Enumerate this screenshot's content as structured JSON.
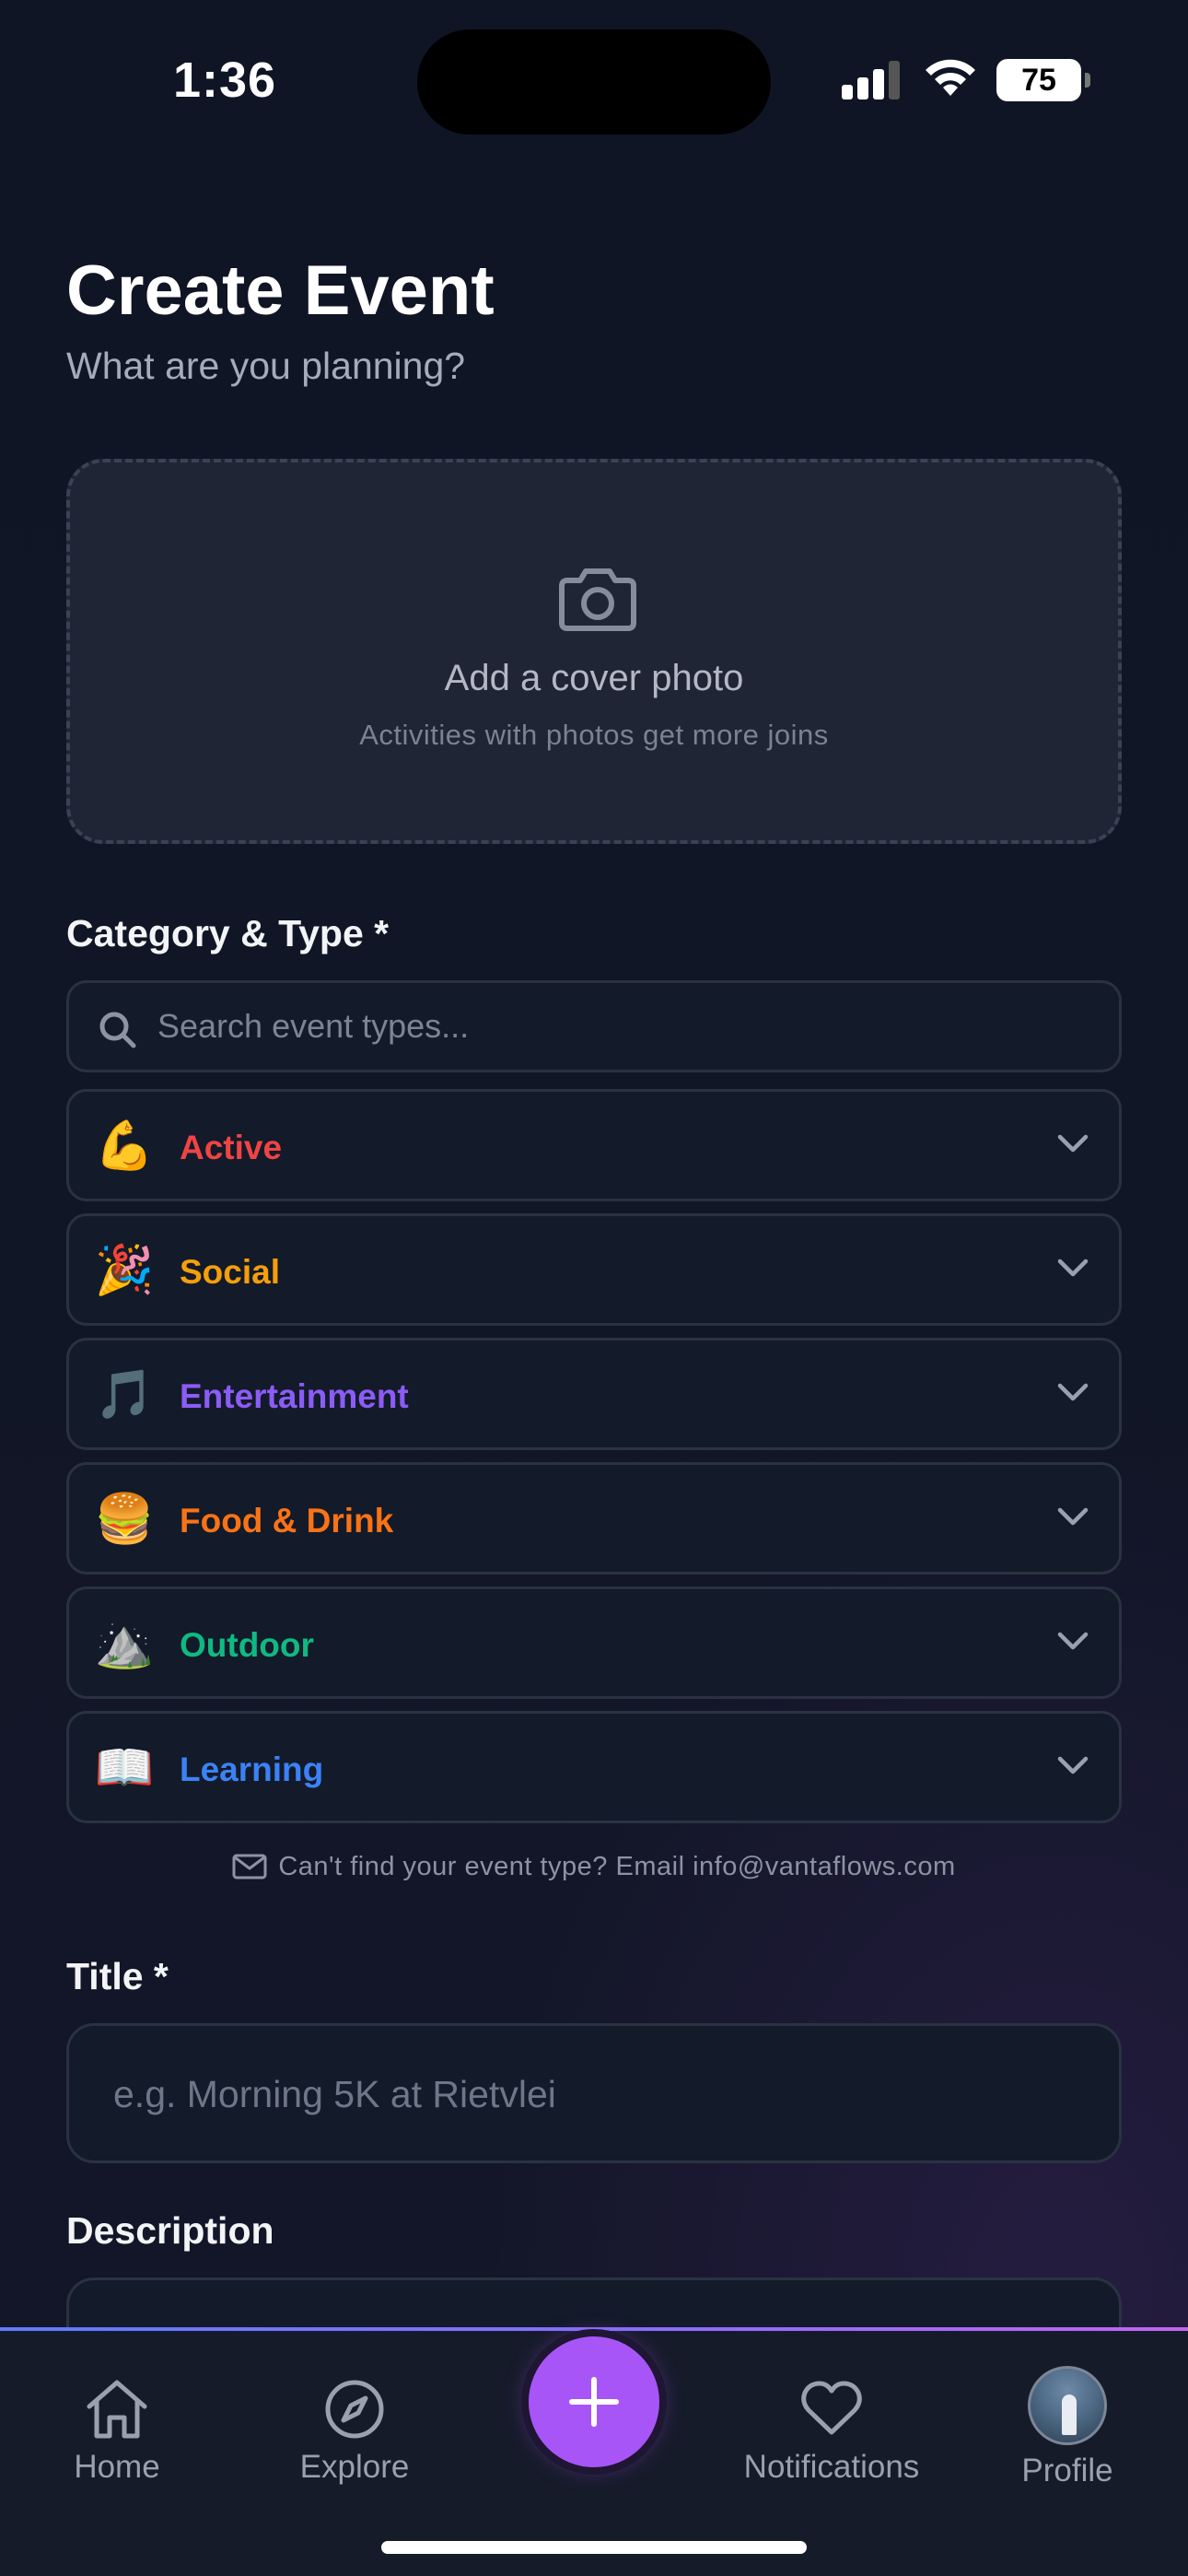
{
  "status_bar": {
    "time": "1:36",
    "battery": "75"
  },
  "header": {
    "title": "Create Event",
    "subtitle": "What are you planning?"
  },
  "cover": {
    "title": "Add a cover photo",
    "subtitle": "Activities with photos get more joins"
  },
  "category_section": {
    "label": "Category & Type *",
    "search_placeholder": "Search event types...",
    "categories": [
      {
        "emoji": "💪",
        "label": "Active",
        "color": "#ef4444"
      },
      {
        "emoji": "🎉",
        "label": "Social",
        "color": "#f59e0b"
      },
      {
        "emoji": "🎵",
        "label": "Entertainment",
        "color": "#8b5cf6"
      },
      {
        "emoji": "🍔",
        "label": "Food & Drink",
        "color": "#f97316"
      },
      {
        "emoji": "⛰️",
        "label": "Outdoor",
        "color": "#10b981"
      },
      {
        "emoji": "📖",
        "label": "Learning",
        "color": "#3b82f6"
      }
    ],
    "help_text": "Can't find your event type? Email info@vantaflows.com"
  },
  "title_field": {
    "label": "Title *",
    "placeholder": "e.g. Morning 5K at Rietvlei"
  },
  "description_field": {
    "label": "Description"
  },
  "nav": {
    "items": [
      {
        "label": "Home",
        "icon": "home-icon"
      },
      {
        "label": "Explore",
        "icon": "compass-icon"
      },
      {
        "label": "Notifications",
        "icon": "heart-icon"
      },
      {
        "label": "Profile",
        "icon": "avatar"
      }
    ],
    "accent": "#a855f7"
  }
}
